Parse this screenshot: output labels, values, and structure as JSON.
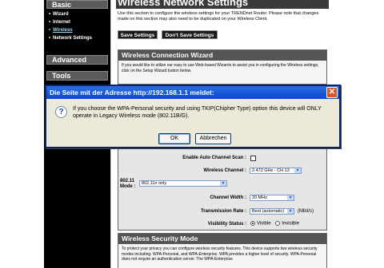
{
  "nav": {
    "basic_label": "Basic",
    "basic_items": [
      {
        "label": "Wizard"
      },
      {
        "label": "Internet"
      },
      {
        "label": "Wireless"
      },
      {
        "label": "Network Settings"
      }
    ],
    "advanced_label": "Advanced",
    "tools_label": "Tools"
  },
  "page": {
    "title": "Wireless Network Settings",
    "intro": "Use this section to configure the wireless settings for your TRENDnet Router. Please note that changes made on this section may also need to be duplicated on your Wireless Client.",
    "save_label": "Save Settings",
    "dont_save_label": "Don't Save Settings"
  },
  "wizard": {
    "title": "Wireless Connection Wizard",
    "body": "If you would like to utilize our easy to use Web-based Wizards to assist you in configuring the Wireless settings, click on the Setup Wizard button below."
  },
  "dialog": {
    "title": "Die Seite mit der Adresse http://192.168.1.1 meldet:",
    "message": "If you choose the WPA-Personal security and using TKIP(Chipher Type) option this device will ONLY operate in Legacy Wireless mode (802.11B/G).",
    "ok_label": "OK",
    "cancel_label": "Abbrechen"
  },
  "settings": {
    "auto_scan_label": "Enable Auto Channel Scan :",
    "auto_scan_checked": false,
    "channel_label": "Wireless Channel :",
    "channel_value": "2.472 GHz - CH 13",
    "mode_label": "802.11 Mode :",
    "mode_value": "802.11n only",
    "width_label": "Channel Width :",
    "width_value": "20 MHz",
    "rate_label": "Transmission Rate :",
    "rate_value": "Best (automatic)",
    "rate_unit": "(Mbit/s)",
    "visibility_label": "Visibility Status :",
    "visible_label": "Visible",
    "invisible_label": "Invisible",
    "visibility_selected": "Visible"
  },
  "security": {
    "title": "Wireless Security Mode",
    "body": "To protect your privacy you can configure wireless security features. This device supports two wireless security modes including: WPA-Personal, and WPA-Enterprise. WPA provides a higher level of security. WPA-Personal does not require an authentication server. The WPA-Enterprise"
  },
  "colors": {
    "nav_bg": "#000000",
    "dialog_title_bg": "#0a49c7",
    "dialog_bg": "#ece9d8"
  }
}
